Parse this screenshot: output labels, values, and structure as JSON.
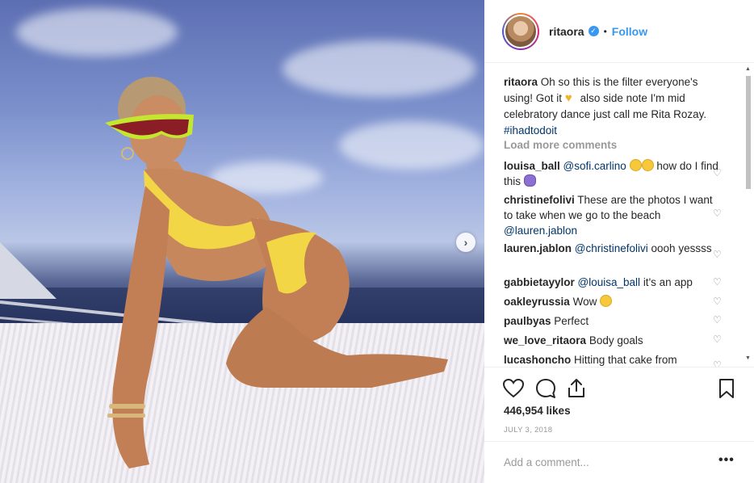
{
  "post": {
    "username": "ritaora",
    "verified_icon": "verified-badge-icon",
    "follow_separator": "•",
    "follow_label": "Follow",
    "caption_user": "ritaora",
    "caption_text_1": "Oh so this is the filter everyone's using! Got it",
    "caption_text_2": "also side note I'm mid celebratory dance just call me Rita Rozay.",
    "hashtag": "#ihadtodoit",
    "load_more": "Load more comments",
    "likes": "446,954 likes",
    "date": "JULY 3, 2018",
    "add_comment_placeholder": "Add a comment...",
    "more_label": "•••"
  },
  "comments": [
    {
      "user": "louisa_ball",
      "mention": "@sofi.carlino",
      "text": "how do I find this"
    },
    {
      "user": "christinefolivi",
      "text": "These are the photos I want to take when we go to the beach",
      "mention": "@lauren.jablon"
    },
    {
      "user": "lauren.jablon",
      "mention": "@christinefolivi",
      "text": "oooh yessss"
    },
    {
      "user": "gabbietayylor",
      "mention": "@louisa_ball",
      "text": "it's an app"
    },
    {
      "user": "oakleyrussia",
      "text": "Wow"
    },
    {
      "user": "paulbyas",
      "text": "Perfect"
    },
    {
      "user": "we_love_ritaora",
      "text": "Body goals"
    },
    {
      "user": "lucashoncho",
      "text": "Hitting that cake from"
    }
  ],
  "colors": {
    "link": "#3897f0",
    "mention": "#003569",
    "muted": "#999999"
  },
  "icons": [
    "heart-icon",
    "comment-icon",
    "share-icon",
    "bookmark-icon",
    "next-arrow-icon"
  ]
}
